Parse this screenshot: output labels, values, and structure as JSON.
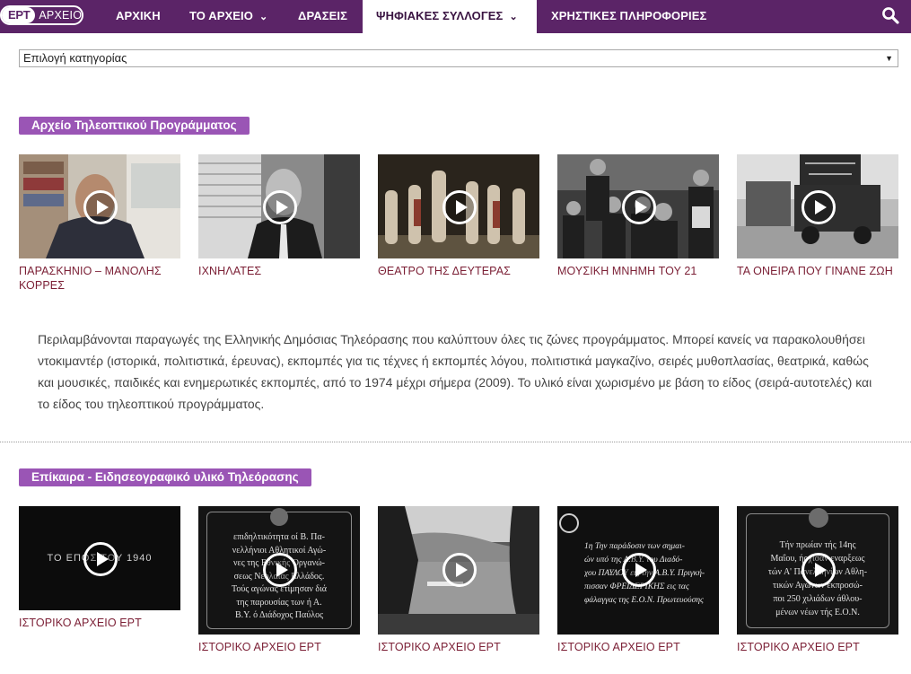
{
  "logo": {
    "brand": "ΕΡΤ",
    "subtitle": "ΑΡΧΕΙΟ"
  },
  "nav": {
    "items": [
      {
        "label": "ΑΡΧΙΚΗ"
      },
      {
        "label": "ΤΟ ΑΡΧΕΙΟ"
      },
      {
        "label": "ΔΡΑΣΕΙΣ"
      },
      {
        "label": "ΨΗΦΙΑΚΕΣ ΣΥΛΛΟΓΕΣ"
      },
      {
        "label": "ΧΡΗΣΤΙΚΕΣ ΠΛΗΡΟΦΟΡΙΕΣ"
      }
    ],
    "search_icon": "search-icon"
  },
  "category_select": {
    "value": "Επιλογή κατηγορίας"
  },
  "sections": [
    {
      "title": "Αρχείο Τηλεοπτικού Προγράμματος",
      "items": [
        {
          "title": "ΠΑΡΑΣΚΗΝΙΟ – ΜΑΝΟΛΗΣ ΚΟΡΡΕΣ"
        },
        {
          "title": "ΙΧΝΗΛΑΤΕΣ"
        },
        {
          "title": "ΘΕΑΤΡΟ ΤΗΣ ΔΕΥΤΕΡΑΣ"
        },
        {
          "title": "ΜΟΥΣΙΚΗ ΜΝΗΜΗ ΤΟΥ 21"
        },
        {
          "title": "ΤΑ ΟΝΕΙΡΑ ΠΟΥ ΓΙΝΑΝΕ ΖΩΗ"
        }
      ],
      "description": "Περιλαμβάνονται παραγωγές της Ελληνικής Δημόσιας Τηλεόρασης που καλύπτουν όλες τις ζώνες προγράμματος. Μπορεί κανείς να παρακολουθήσει ντοκιμαντέρ (ιστορικά, πολιτιστικά, έρευνας), εκπομπές για τις τέχνες ή εκπομπές λόγου, πολιτιστικά μαγκαζίνο, σειρές μυθοπλασίας, θεατρικά, καθώς και μουσικές, παιδικές και ενημερωτικές εκπομπές, από το 1974 μέχρι σήμερα (2009). Το υλικό είναι χωρισμένο με βάση το είδος (σειρά-αυτοτελές) και το είδος του τηλεοπτικού προγράμματος."
    },
    {
      "title": "Επίκαιρα - Ειδησεογραφικό υλικό Τηλεόρασης",
      "items": [
        {
          "title": "ΙΣΤΟΡΙΚΟ ΑΡΧΕΙΟ ΕΡΤ",
          "thumb_text": [
            "ΤΟ ΕΠΟΣ ΤΟΥ 1940"
          ]
        },
        {
          "title": "ΙΣΤΟΡΙΚΟ ΑΡΧΕΙΟ ΕΡΤ",
          "thumb_text": [
            "επιδηλτικότητα οί Β. Πα-",
            "νελλήνιοι Αθλητικοί Αγώ-",
            "νες της Εθνικής Οργανώ-",
            "σεως Νεολαίας Ελλάδος.",
            "Τούς αγώνας ετίμησαν διά",
            "της παρουσίας των ή Α.",
            "Β.Υ. ό Διάδοχος Παύλος"
          ]
        },
        {
          "title": "ΙΣΤΟΡΙΚΟ ΑΡΧΕΙΟ ΕΡΤ"
        },
        {
          "title": "ΙΣΤΟΡΙΚΟ ΑΡΧΕΙΟ ΕΡΤ",
          "thumb_text": [
            "1η Την παράδοσιν των σημαι-",
            "ών υπό της Α.Β.Υ. του Διαδό-",
            "χου ΠΑΥΛΟΥ εις την Α.Β.Υ. Πριγκή-",
            "πισσαν ΦΡΕΙΔΕΡΙΚΗΣ εις τας",
            "φάλαγγας της Ε.Ο.Ν. Πρωτευούσης"
          ]
        },
        {
          "title": "ΙΣΤΟΡΙΚΟ ΑΡΧΕΙΟ ΕΡΤ",
          "thumb_text": [
            "Τήν πρωίαν τής 14ης",
            "Μαΐου, ήρχισαν εναρξεως",
            "τών Α' Πανελληνίων Αθλη-",
            "τικών Αγώνων εκπροσώ-",
            "ποι 250 χιλιάδων άθλου-",
            "μένων νέων τής Ε.Ο.Ν."
          ]
        }
      ]
    }
  ],
  "colors": {
    "nav_bg": "#5b2467",
    "section_badge": "#9a55b5",
    "title_link": "#7b1f35"
  }
}
